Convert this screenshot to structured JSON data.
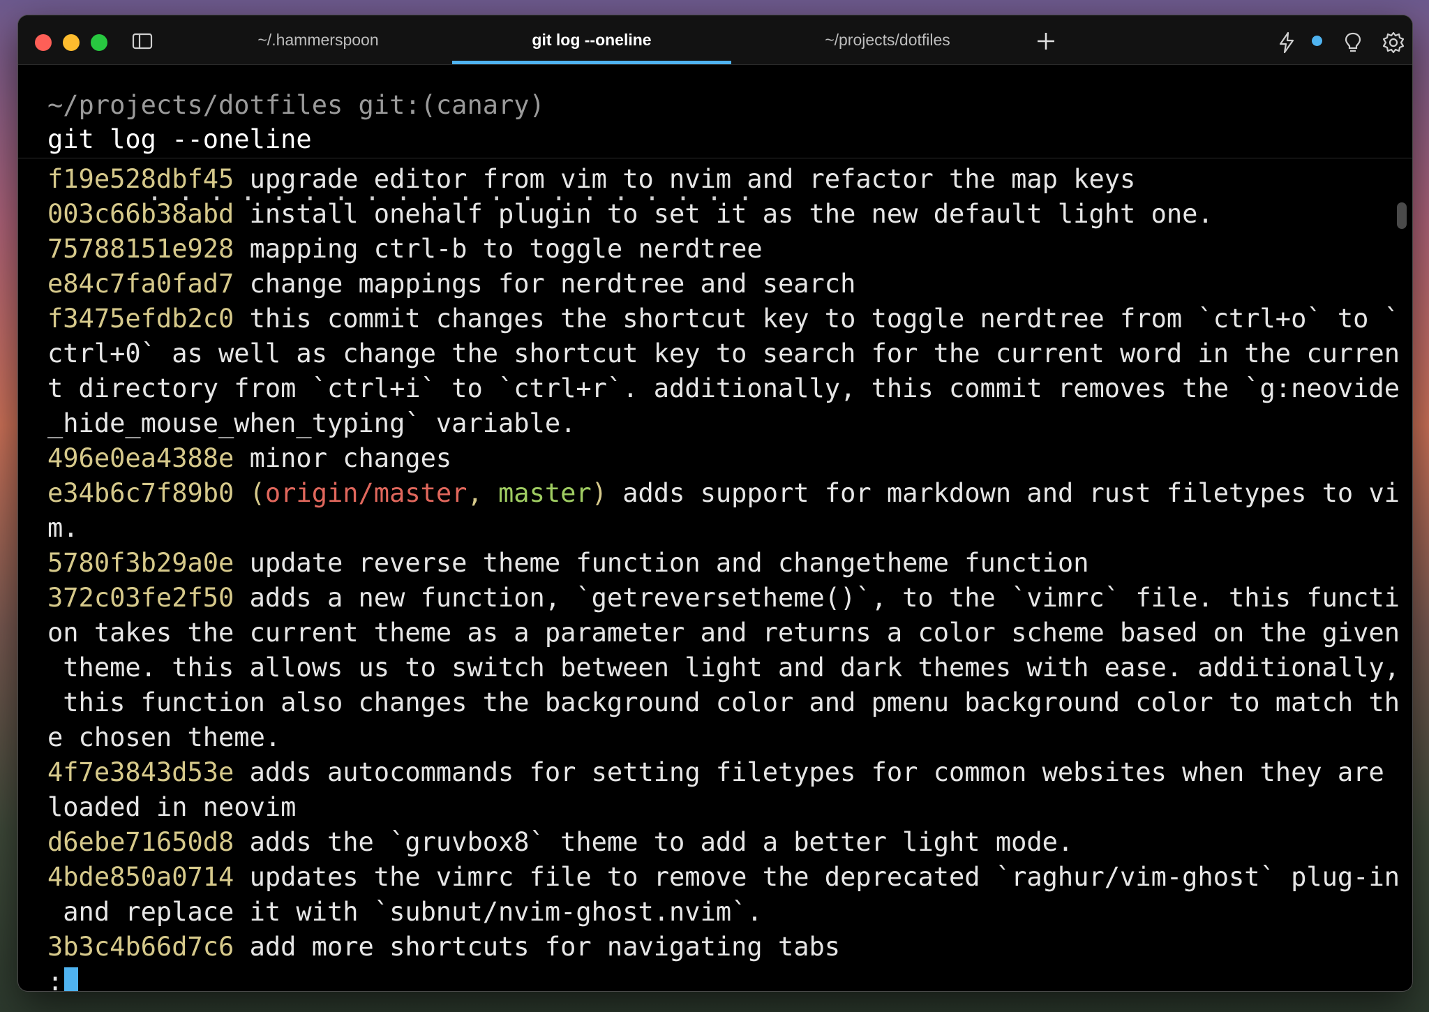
{
  "tabs": [
    {
      "label": "~/.hammerspoon"
    },
    {
      "label": "git log --oneline"
    },
    {
      "label": "~/projects/dotfiles"
    }
  ],
  "terminal": {
    "prompt": "~/projects/dotfiles git:(canary)",
    "command": "git log --oneline",
    "cut_line": "  . . . . . . . . . . . . . . . . . . . .",
    "pager_prompt": ":"
  },
  "commits": [
    {
      "hash": "f19e528dbf45",
      "lines": [
        " upgrade editor from vim to nvim and refactor the map keys"
      ]
    },
    {
      "hash": "003c66b38abd",
      "lines": [
        " install onehalf plugin to set it as the new default light one."
      ]
    },
    {
      "hash": "75788151e928",
      "lines": [
        " mapping ctrl-b to toggle nerdtree"
      ]
    },
    {
      "hash": "e84c7fa0fad7",
      "lines": [
        " change mappings for nerdtree and search"
      ]
    },
    {
      "hash": "f3475efdb2c0",
      "lines": [
        " this commit changes the shortcut key to toggle nerdtree from `ctrl+o` to `",
        "ctrl+0` as well as change the shortcut key to search for the current word in the curren",
        "t directory from `ctrl+i` to `ctrl+r`. additionally, this commit removes the `g:neovide",
        "_hide_mouse_when_typing` variable."
      ]
    },
    {
      "hash": "496e0ea4388e",
      "lines": [
        " minor changes"
      ]
    },
    {
      "hash": "e34b6c7f89b0",
      "refs": {
        "open": " (",
        "origin": "origin/master",
        "sep": ", ",
        "local": "master",
        "close": ")"
      },
      "lines": [
        " adds support for markdown and rust filetypes to vi",
        "m."
      ]
    },
    {
      "hash": "5780f3b29a0e",
      "lines": [
        " update reverse theme function and changetheme function"
      ]
    },
    {
      "hash": "372c03fe2f50",
      "lines": [
        " adds a new function, `getreversetheme()`, to the `vimrc` file. this functi",
        "on takes the current theme as a parameter and returns a color scheme based on the given",
        " theme. this allows us to switch between light and dark themes with ease. additionally,",
        " this function also changes the background color and pmenu background color to match th",
        "e chosen theme."
      ]
    },
    {
      "hash": "4f7e3843d53e",
      "lines": [
        " adds autocommands for setting filetypes for common websites when they are",
        "loaded in neovim"
      ]
    },
    {
      "hash": "d6ebe71650d8",
      "lines": [
        " adds the `gruvbox8` theme to add a better light mode."
      ]
    },
    {
      "hash": "4bde850a0714",
      "lines": [
        " updates the vimrc file to remove the deprecated `raghur/vim-ghost` plug-in",
        " and replace it with `subnut/nvim-ghost.nvim`."
      ]
    },
    {
      "hash": "3b3c4b66d7c6",
      "lines": [
        " add more shortcuts for navigating tabs"
      ]
    }
  ],
  "icons": {
    "traffic_lights": [
      "close-icon",
      "minimize-icon",
      "zoom-icon"
    ],
    "titlebar_right": [
      "bolt-icon",
      "notification-dot-icon",
      "lightbulb-icon",
      "gear-icon"
    ]
  },
  "colors": {
    "background": "#000000",
    "hash": "#d6c98b",
    "ref_origin": "#e0675c",
    "ref_master": "#9fcc62",
    "accent": "#4fb3f0",
    "prompt": "#9a9a9a",
    "text": "#e6e6e6"
  }
}
